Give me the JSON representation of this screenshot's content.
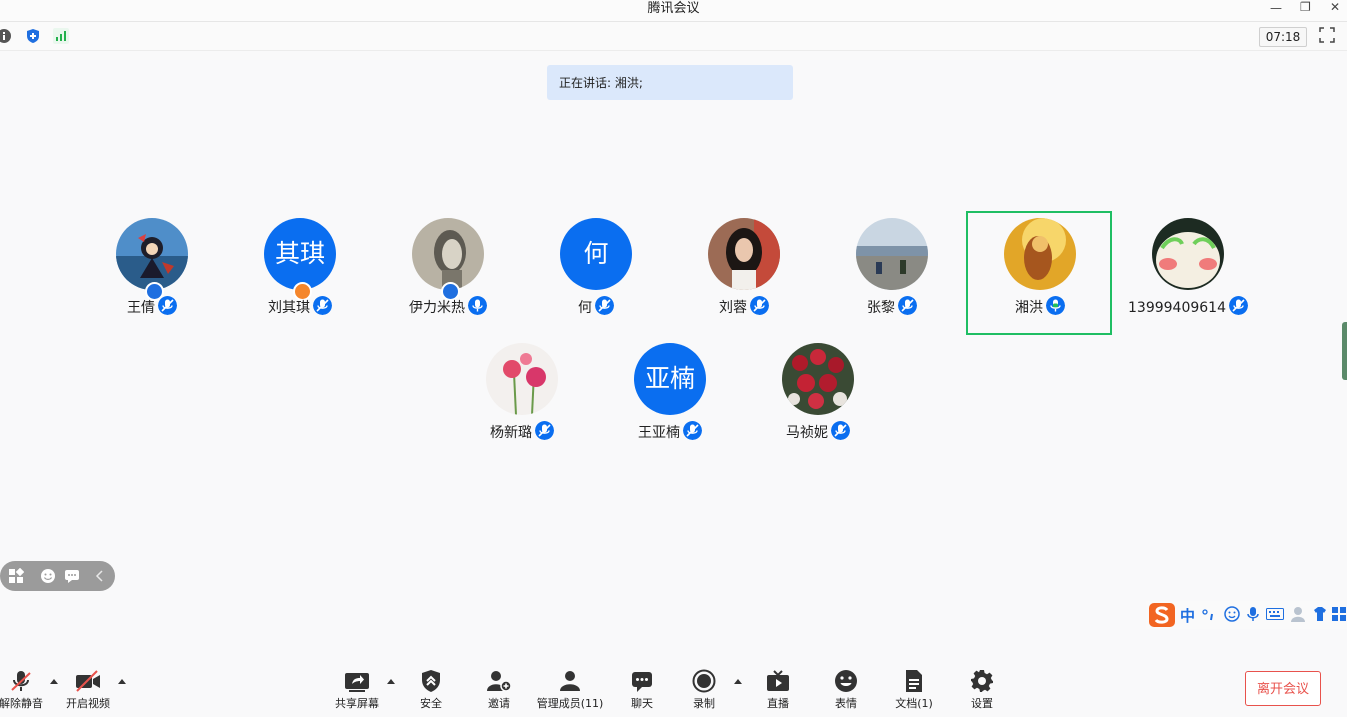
{
  "window": {
    "title": "腾讯会议",
    "minimize": "—",
    "restore": "❐",
    "close": "✕"
  },
  "topbar": {
    "timer": "07:18"
  },
  "speaking": {
    "text": "正在讲话: 湘洪;"
  },
  "participants": [
    {
      "name": "王倩",
      "avatar_text": ""
    },
    {
      "name": "刘其琪",
      "avatar_text": "其琪"
    },
    {
      "name": "伊力米热",
      "avatar_text": ""
    },
    {
      "name": "何",
      "avatar_text": "何"
    },
    {
      "name": "刘蓉",
      "avatar_text": ""
    },
    {
      "name": "张黎",
      "avatar_text": ""
    },
    {
      "name": "湘洪",
      "avatar_text": ""
    },
    {
      "name": "13999409614",
      "avatar_text": ""
    },
    {
      "name": "杨新璐",
      "avatar_text": ""
    },
    {
      "name": "王亚楠",
      "avatar_text": "亚楠"
    },
    {
      "name": "马祯妮",
      "avatar_text": ""
    }
  ],
  "colors": {
    "accent": "#0a6ef0",
    "active_speaker": "#1fbe63",
    "leave": "#e8524c",
    "host_badge": "#f5862b"
  },
  "ime": {
    "label": "中"
  },
  "toolbar": {
    "unmute": "解除静音",
    "start_video": "开启视频",
    "share_screen": "共享屏幕",
    "security": "安全",
    "invite": "邀请",
    "manage_members": "管理成员(11)",
    "chat": "聊天",
    "record": "录制",
    "live": "直播",
    "reactions": "表情",
    "documents": "文档(1)",
    "settings": "设置",
    "leave": "离开会议"
  }
}
